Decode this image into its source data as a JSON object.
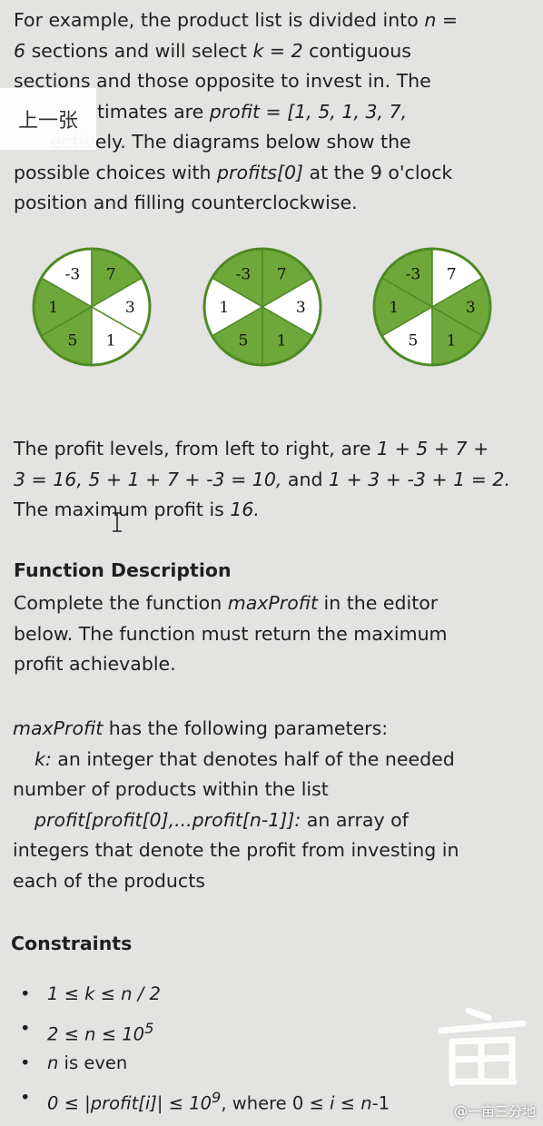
{
  "intro": {
    "line1a": "For example, the product list is divided into ",
    "n_var": "n",
    "line1b": " =",
    "six": "6",
    "line2a": " sections and will select ",
    "k_var": "k",
    "line2b": " = ",
    "two": "2",
    "line2c": " contiguous",
    "line3": "sections and those opposite to invest in. The",
    "line4a": "timates are ",
    "profit_list": "profit = [1, 5, 1, 3, 7,",
    "line5": "ectively. The diagrams below show the",
    "line6a": "possible choices with ",
    "profit0": "profits[0]",
    "line6b": " at the 9 o'clock",
    "line7": "position and filling counterclockwise."
  },
  "wheels": [
    {
      "labels": [
        "-3",
        "7",
        "3",
        "1",
        "5",
        "1"
      ],
      "shaded": [
        false,
        true,
        false,
        true,
        true,
        false
      ]
    },
    {
      "labels": [
        "-3",
        "7",
        "3",
        "1",
        "5",
        "1"
      ],
      "shaded": [
        true,
        true,
        false,
        false,
        true,
        true
      ]
    },
    {
      "labels": [
        "-3",
        "7",
        "3",
        "1",
        "5",
        "1"
      ],
      "shaded": [
        true,
        false,
        true,
        true,
        false,
        true
      ]
    }
  ],
  "colors": {
    "green": "#6fa83a",
    "white": "#ffffff",
    "stroke": "#4e8a24"
  },
  "levels": {
    "line1a": "The profit levels, from left to right, are ",
    "expr1a": "1 + 5 + 7 +",
    "expr1b": "3 = 16, 5 + 1 + 7 + -3 = 10,",
    "and": " and ",
    "expr2": "1 + 3 + -3 + 1 = 2.",
    "line3a": "The maximum profit is ",
    "max": "16."
  },
  "function_description": {
    "heading": "Function Description",
    "line1a": "Complete the function ",
    "fn": "maxProfit",
    "line1b": " in the editor",
    "line2": "below. The function must return the maximum",
    "line3": "profit achievable."
  },
  "params": {
    "fn": "maxProfit",
    "intro": " has the following parameters:",
    "k_name": "k:",
    "k_desc1": " an integer that denotes half of the needed",
    "k_desc2": "number of products within the list",
    "profit_name": "profit[profit[0],...profit[n-1]]:",
    "profit_desc1": "  an array of",
    "profit_desc2": "integers that denote the profit from investing in",
    "profit_desc3": "each of the products"
  },
  "constraints": {
    "heading": "Constraints",
    "c1": "1 ≤ k ≤ n / 2",
    "c2a": "2 ≤ n ≤ 10",
    "c2exp": "5",
    "c3a": "n",
    "c3b": " is even",
    "c4a": "0 ≤ |profit[i]| ≤ 10",
    "c4exp": "9",
    "c4b": ", where 0 ≤ ",
    "c4i": "i",
    "c4c": " ≤ ",
    "c4n": "n",
    "c4d": "-1"
  },
  "overlay": {
    "prev_label": "上一张"
  },
  "watermark": {
    "text": "@一亩三分地"
  }
}
